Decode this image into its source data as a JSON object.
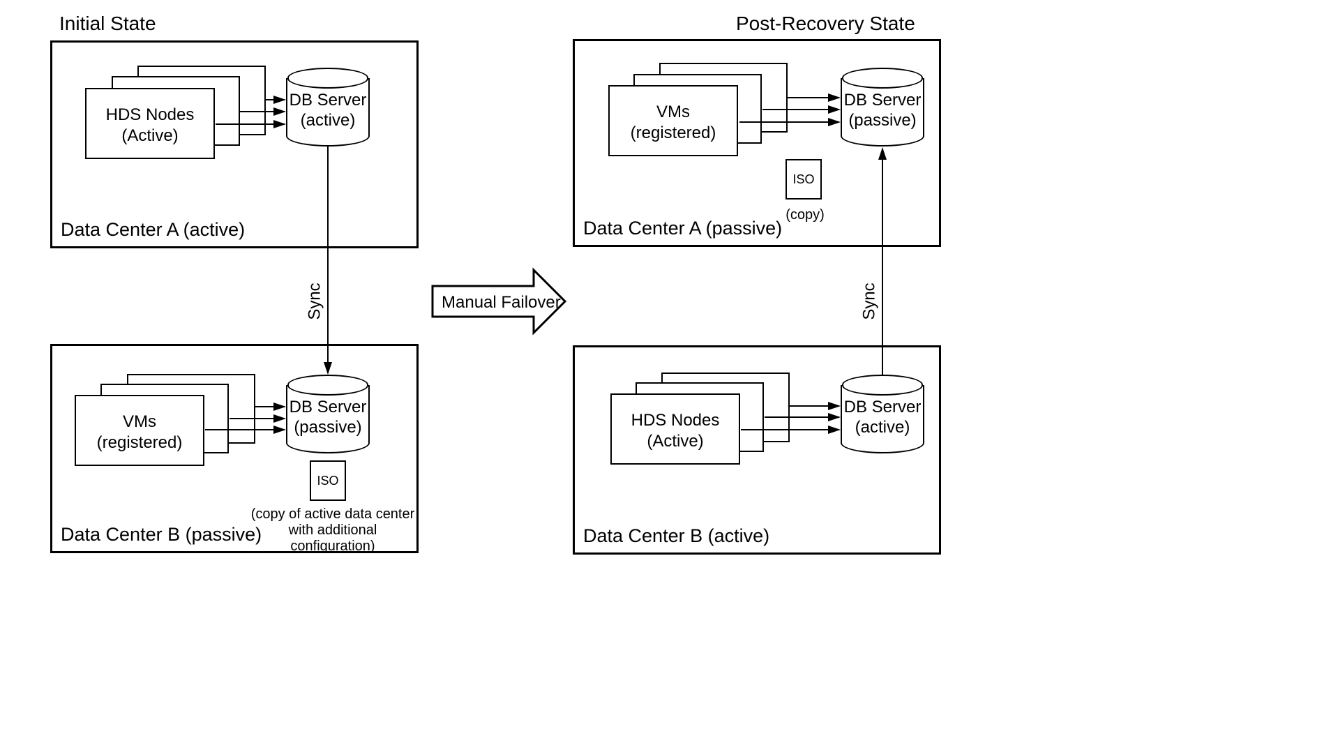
{
  "titles": {
    "initial": "Initial State",
    "post": "Post-Recovery State"
  },
  "initial": {
    "dcA": {
      "label": "Data Center A (active)",
      "nodes": "HDS Nodes\n(Active)",
      "db": "DB Server\n(active)"
    },
    "dcB": {
      "label": "Data Center B (passive)",
      "nodes": "VMs\n(registered)",
      "db": "DB Server\n(passive)",
      "iso": "ISO",
      "isoCaption": "(copy of active data center with additional configuration)"
    },
    "sync": "Sync"
  },
  "failover": "Manual Failover",
  "post": {
    "dcA": {
      "label": "Data Center A (passive)",
      "nodes": "VMs\n(registered)",
      "db": "DB Server\n(passive)",
      "iso": "ISO",
      "isoCaption": "(copy)"
    },
    "dcB": {
      "label": "Data Center B (active)",
      "nodes": "HDS Nodes\n(Active)",
      "db": "DB Server\n(active)"
    },
    "sync": "Sync"
  }
}
